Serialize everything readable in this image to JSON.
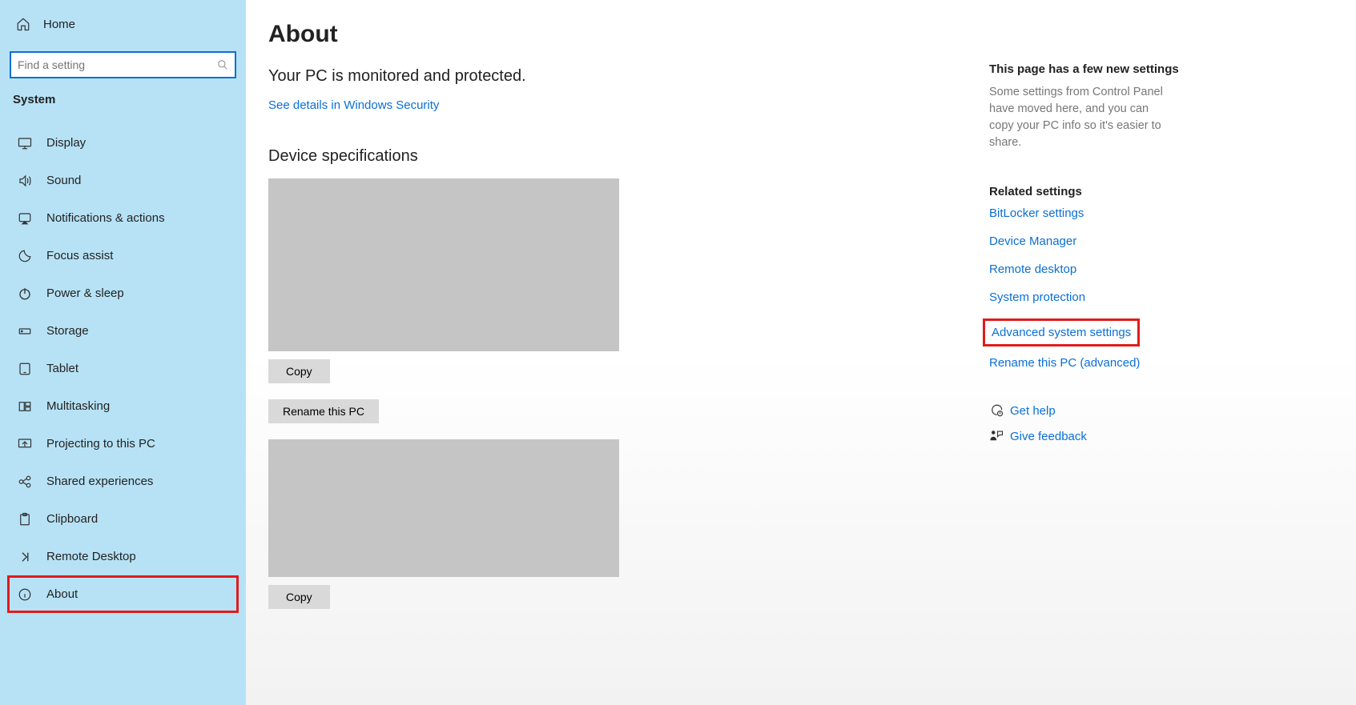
{
  "sidebar": {
    "home_label": "Home",
    "search_placeholder": "Find a setting",
    "category": "System",
    "items": [
      {
        "icon": "display",
        "label": "Display"
      },
      {
        "icon": "sound",
        "label": "Sound"
      },
      {
        "icon": "notifications",
        "label": "Notifications & actions"
      },
      {
        "icon": "focus",
        "label": "Focus assist"
      },
      {
        "icon": "power",
        "label": "Power & sleep"
      },
      {
        "icon": "storage",
        "label": "Storage"
      },
      {
        "icon": "tablet",
        "label": "Tablet"
      },
      {
        "icon": "multitask",
        "label": "Multitasking"
      },
      {
        "icon": "project",
        "label": "Projecting to this PC"
      },
      {
        "icon": "shared",
        "label": "Shared experiences"
      },
      {
        "icon": "clipboard",
        "label": "Clipboard"
      },
      {
        "icon": "remote",
        "label": "Remote Desktop"
      },
      {
        "icon": "about",
        "label": "About",
        "highlight": true
      }
    ]
  },
  "main": {
    "title": "About",
    "status_line": "Your PC is monitored and protected.",
    "security_link": "See details in Windows Security",
    "device_spec_heading": "Device specifications",
    "copy1_label": "Copy",
    "rename_label": "Rename this PC",
    "copy2_label": "Copy"
  },
  "right": {
    "new_heading": "This page has a few new settings",
    "new_text": "Some settings from Control Panel have moved here, and you can copy your PC info so it's easier to share.",
    "related_heading": "Related settings",
    "related_links": [
      {
        "label": "BitLocker settings"
      },
      {
        "label": "Device Manager"
      },
      {
        "label": "Remote desktop"
      },
      {
        "label": "System protection"
      },
      {
        "label": "Advanced system settings",
        "highlight": true
      },
      {
        "label": "Rename this PC (advanced)"
      }
    ],
    "help_label": "Get help",
    "feedback_label": "Give feedback"
  }
}
